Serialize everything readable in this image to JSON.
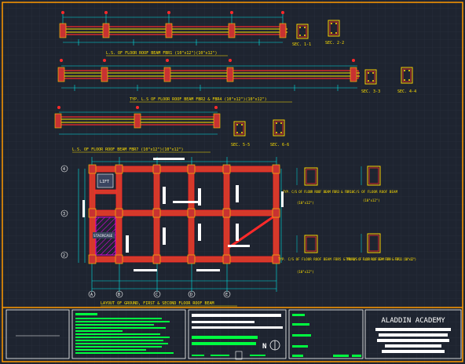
{
  "colors": {
    "background": "#1e2430",
    "grid": "#2b3340",
    "frame": "#ff9a00",
    "beam": "#ff2a2a",
    "beam_fill": "#d43a2a",
    "column": "#c83232",
    "column_edge": "#ffd000",
    "rebar": "#ffe400",
    "dimension": "#00e5e5",
    "label": "#ffe000",
    "note": "#00ff40",
    "white": "#ffffff",
    "magenta": "#ff00ff",
    "slab": "#3a4560"
  },
  "drawings": {
    "beam1_title": "L.S. OF FLOOR ROOF BEAM FBR1 (10\"x12\")(10\"x12\")",
    "beam2_title": "TYP. L.S OF FLOOR ROOF BEAM FBR2 & FBR4 (10\"x12\")(10\"x12\")",
    "beam3_title": "L.S. OF FLOOR ROOF BEAM FBR7 (10\"x12\")(10\"x12\")",
    "sections": {
      "s1": "SEC. 1-1",
      "s2": "SEC. 2-2",
      "s3": "SEC. 3-3",
      "s4": "SEC. 4-4",
      "s5": "SEC. 5-5",
      "s6": "SEC. 6-6"
    },
    "detail_a_title": "TYP. C/S OF FLOOR ROOF BEAM FBR3 & FBR10",
    "detail_a_dim": "(10\"x12\")",
    "detail_b_title": "C/S OF FLOOR ROOF BEAM",
    "detail_b_dim": "(10\"x12\")",
    "detail_c_title": "TYP. C/S OF FLOOR ROOF BEAM FBR5 & FBR8",
    "detail_c_dim": "(10\"x12\")",
    "detail_d_title": "TYP. C/S OF FLOOR ROOF BEAM FBR9 & FBR11 (10\"x12\")",
    "plan_title": "LAYOUT OF GROUND, FIRST & SECOND FLOOR ROOF BEAM",
    "plan_labels": {
      "lift": "LIFT",
      "staircase": "STAIRCASE"
    },
    "grid_rows": [
      "4",
      "3",
      "2"
    ],
    "grid_cols": [
      "A",
      "B",
      "C",
      "D",
      "E"
    ]
  },
  "title_block": {
    "company": "ALADDIN ACADEMY",
    "logo": "N"
  }
}
